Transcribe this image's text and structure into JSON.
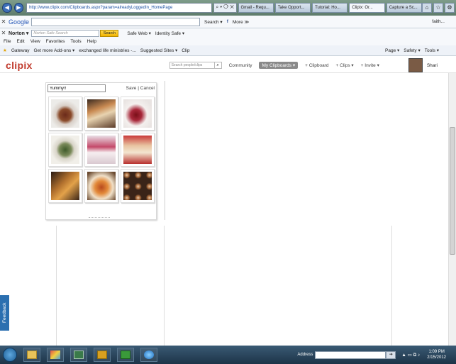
{
  "browser": {
    "address": "http://www.clipix.com/Clipboards.aspx?param=alreadyLoggedIn_HomePage",
    "address_icons": "⌕ ▾ ⟳ ✕",
    "tabs": [
      "Gmail - Requ...",
      "Take Opport...",
      "Tutorial: Ho...",
      "Clipix: Or...",
      "Capture a Sc..."
    ],
    "active_tab": 3
  },
  "google_bar": {
    "logo": "Google",
    "search_label": "Search ▾",
    "more_label": "More ≫",
    "user_label": "faith..."
  },
  "norton_bar": {
    "logo": "Norton ▾",
    "search_placeholder": "Norton Safe Search",
    "search_button": "Search",
    "safe_web": "Safe Web ▾",
    "identity_safe": "Identity Safe ▾"
  },
  "menu": [
    "File",
    "Edit",
    "View",
    "Favorites",
    "Tools",
    "Help"
  ],
  "favorites": {
    "items": [
      "Gateway",
      "Get more Add-ons ▾",
      "exchanged life ministries -...",
      "Suggested Sites ▾",
      "Clip"
    ],
    "commands": [
      "Page ▾",
      "Safety ▾",
      "Tools ▾"
    ]
  },
  "clipix": {
    "logo": "clipix",
    "search_placeholder": "Search people/clips",
    "nav": {
      "community": "Community",
      "my_clipboards": "My Clipboards ▾",
      "add_clipboard": "+ Clipboard",
      "add_clips": "+ Clips ▾",
      "invite": "+ Invite ▾"
    },
    "user": "Shari"
  },
  "clipboard": {
    "name_value": "Yummy!!",
    "save": "Save",
    "separator": "|",
    "cancel": "Cancel",
    "thumbnails": [
      "food-photo-1",
      "food-photo-2",
      "food-photo-3",
      "food-photo-4",
      "food-photo-5",
      "food-photo-6",
      "food-photo-7",
      "food-photo-8",
      "food-photo-9"
    ]
  },
  "feedback": "Feedback",
  "taskbar": {
    "address_label": "Address",
    "time": "1:09 PM",
    "date": "2/15/2012"
  }
}
